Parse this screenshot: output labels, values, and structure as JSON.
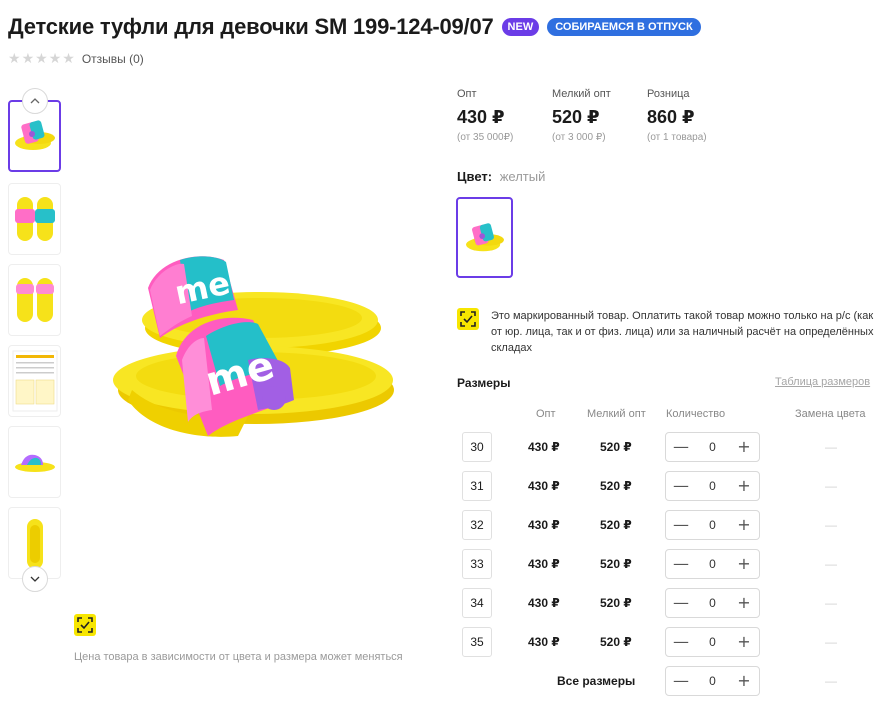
{
  "product": {
    "title": "Детские туфли для девочки SM 199-124-09/07",
    "badge_new": "NEW",
    "badge_vacation": "СОБИРАЕМСЯ В ОТПУСК",
    "rating_stars": 0,
    "reviews": "Отзывы (0)"
  },
  "prices": [
    {
      "label": "Опт",
      "value": "430 ₽",
      "sub": "(от 35 000₽)"
    },
    {
      "label": "Мелкий опт",
      "value": "520 ₽",
      "sub": "(от 3 000 ₽)"
    },
    {
      "label": "Розница",
      "value": "860 ₽",
      "sub": "(от 1 товара)"
    }
  ],
  "color": {
    "label": "Цвет:",
    "value": "желтый"
  },
  "marking_text": "Это маркированный товар. Оплатить такой товар можно только на р/с (как от юр. лица, так и от физ. лица) или за наличный расчёт на определённых складах",
  "price_note": "Цена товара в зависимости от цвета и размера может меняться",
  "sizes": {
    "title": "Размеры",
    "table_link": "Таблица размеров",
    "headers": {
      "opt": "Опт",
      "melk": "Мелкий опт",
      "qty": "Количество",
      "color_change": "Замена цвета"
    },
    "rows": [
      {
        "size": "30",
        "opt": "430 ₽",
        "melk": "520 ₽",
        "qty": "0",
        "dash": "—"
      },
      {
        "size": "31",
        "opt": "430 ₽",
        "melk": "520 ₽",
        "qty": "0",
        "dash": "—"
      },
      {
        "size": "32",
        "opt": "430 ₽",
        "melk": "520 ₽",
        "qty": "0",
        "dash": "—"
      },
      {
        "size": "33",
        "opt": "430 ₽",
        "melk": "520 ₽",
        "qty": "0",
        "dash": "—"
      },
      {
        "size": "34",
        "opt": "430 ₽",
        "melk": "520 ₽",
        "qty": "0",
        "dash": "—"
      },
      {
        "size": "35",
        "opt": "430 ₽",
        "melk": "520 ₽",
        "qty": "0",
        "dash": "—"
      }
    ],
    "all": {
      "label": "Все размеры",
      "qty": "0",
      "dash": "—"
    }
  },
  "stepper": {
    "minus": "—",
    "plus": "+"
  },
  "colors": {
    "accent": "#6b3ce7",
    "badge_blue": "#2f6fe0",
    "mark_yellow": "#f7e600",
    "sandal_yellow": "#f6e21a"
  },
  "icons": {
    "up": "chevron-up-icon",
    "down": "chevron-down-icon",
    "mark": "datamatrix-icon",
    "star": "star-icon"
  }
}
